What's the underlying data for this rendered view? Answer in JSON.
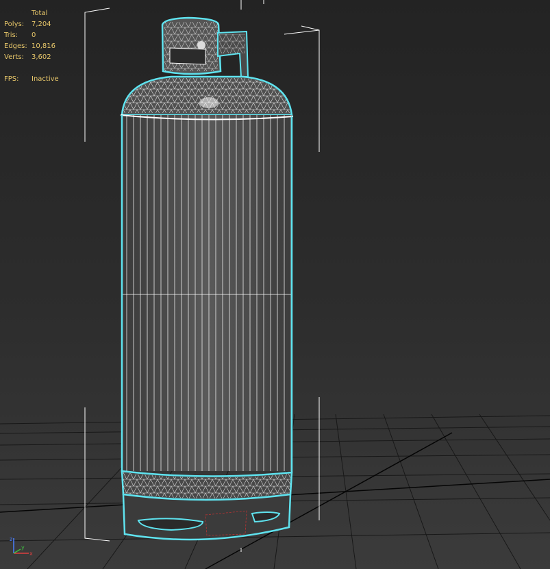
{
  "stats": {
    "header": "Total",
    "rows": [
      {
        "label": "Polys:",
        "value": "7,204"
      },
      {
        "label": "Tris:",
        "value": "0"
      },
      {
        "label": "Edges:",
        "value": "10,816"
      },
      {
        "label": "Verts:",
        "value": "3,602"
      }
    ],
    "fps_label": "FPS:",
    "fps_value": "Inactive"
  },
  "colors": {
    "stats_text": "#e8c76a",
    "selection_outline": "#5fe3ef",
    "wire": "#ffffff",
    "grid": "#111111"
  },
  "gizmo": {
    "x_label": "x",
    "y_label": "y",
    "z_label": "z"
  }
}
